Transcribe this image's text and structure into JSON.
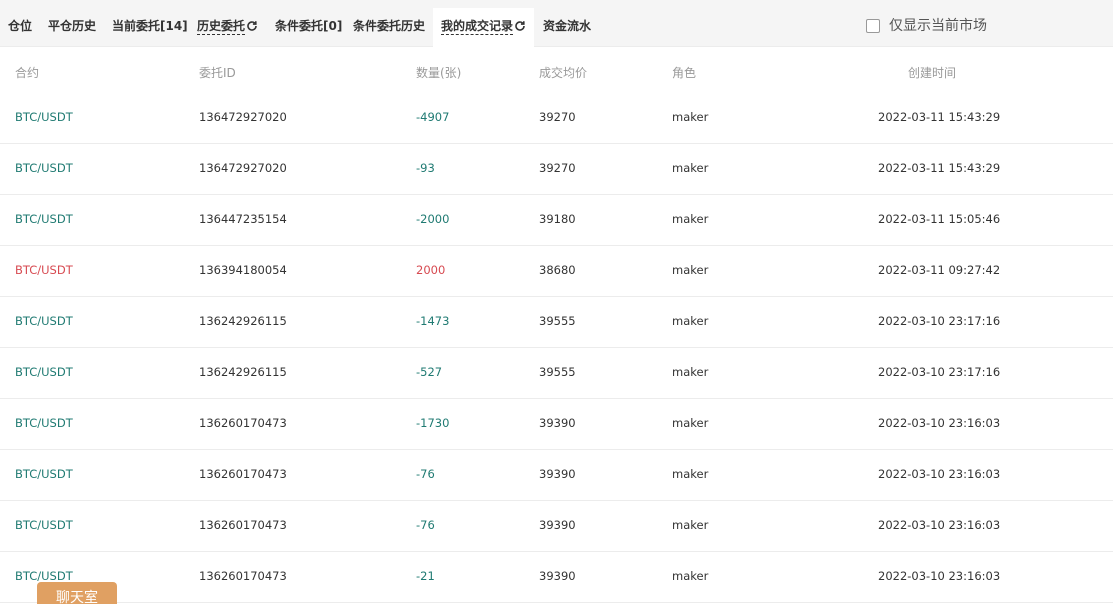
{
  "tabs": [
    {
      "label": "仓位"
    },
    {
      "label": "平仓历史"
    },
    {
      "label": "当前委托[14]"
    },
    {
      "label": "历史委托"
    },
    {
      "label": "条件委托[0]"
    },
    {
      "label": "条件委托历史"
    },
    {
      "label": "我的成交记录"
    },
    {
      "label": "资金流水"
    }
  ],
  "active_tab": "我的成交记录",
  "filter": {
    "label": "仅显示当前市场",
    "checked": false
  },
  "table": {
    "headers": {
      "contract": "合约",
      "order_id": "委托ID",
      "quantity": "数量(张)",
      "avg_price": "成交均价",
      "role": "角色",
      "created_time": "创建时间"
    },
    "rows": [
      {
        "contract": "BTC/USDT",
        "order_id": "136472927020",
        "quantity": "-4907",
        "avg_price": "39270",
        "role": "maker",
        "created_time": "2022-03-11 15:43:29",
        "side": "sell"
      },
      {
        "contract": "BTC/USDT",
        "order_id": "136472927020",
        "quantity": "-93",
        "avg_price": "39270",
        "role": "maker",
        "created_time": "2022-03-11 15:43:29",
        "side": "sell"
      },
      {
        "contract": "BTC/USDT",
        "order_id": "136447235154",
        "quantity": "-2000",
        "avg_price": "39180",
        "role": "maker",
        "created_time": "2022-03-11 15:05:46",
        "side": "sell"
      },
      {
        "contract": "BTC/USDT",
        "order_id": "136394180054",
        "quantity": "2000",
        "avg_price": "38680",
        "role": "maker",
        "created_time": "2022-03-11 09:27:42",
        "side": "buy"
      },
      {
        "contract": "BTC/USDT",
        "order_id": "136242926115",
        "quantity": "-1473",
        "avg_price": "39555",
        "role": "maker",
        "created_time": "2022-03-10 23:17:16",
        "side": "sell"
      },
      {
        "contract": "BTC/USDT",
        "order_id": "136242926115",
        "quantity": "-527",
        "avg_price": "39555",
        "role": "maker",
        "created_time": "2022-03-10 23:17:16",
        "side": "sell"
      },
      {
        "contract": "BTC/USDT",
        "order_id": "136260170473",
        "quantity": "-1730",
        "avg_price": "39390",
        "role": "maker",
        "created_time": "2022-03-10 23:16:03",
        "side": "sell"
      },
      {
        "contract": "BTC/USDT",
        "order_id": "136260170473",
        "quantity": "-76",
        "avg_price": "39390",
        "role": "maker",
        "created_time": "2022-03-10 23:16:03",
        "side": "sell"
      },
      {
        "contract": "BTC/USDT",
        "order_id": "136260170473",
        "quantity": "-76",
        "avg_price": "39390",
        "role": "maker",
        "created_time": "2022-03-10 23:16:03",
        "side": "sell"
      },
      {
        "contract": "BTC/USDT",
        "order_id": "136260170473",
        "quantity": "-21",
        "avg_price": "39390",
        "role": "maker",
        "created_time": "2022-03-10 23:16:03",
        "side": "sell"
      }
    ]
  },
  "chat_button": {
    "label": "聊天室"
  },
  "colors": {
    "sell": "#1f7a72",
    "buy": "#d74a51",
    "chat": "#e0a062"
  }
}
